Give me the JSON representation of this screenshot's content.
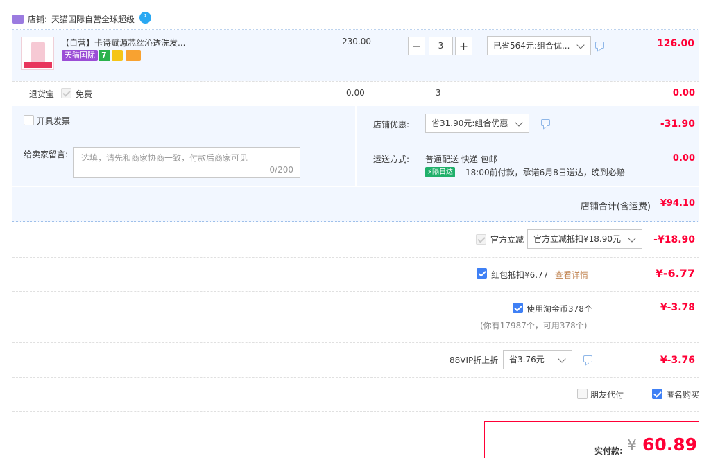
{
  "shop": {
    "label": "店铺:",
    "name": "天猫国际自营全球超级"
  },
  "product": {
    "title": "【自营】卡诗赋源芯丝沁透洗发...",
    "tag": "天猫国际",
    "price": "230.00",
    "qty": "3",
    "discount_select": "已省564元:组合优...",
    "subtotal": "126.00"
  },
  "return_insurance": {
    "label": "退货宝",
    "option": "免费",
    "price": "0.00",
    "qty": "3",
    "total": "0.00"
  },
  "invoice": {
    "label": "开具发票"
  },
  "message": {
    "label": "给卖家留言:",
    "placeholder": "选填，请先和商家协商一致，付款后商家可见",
    "count": "0/200"
  },
  "shop_discount": {
    "label": "店铺优惠:",
    "select": "省31.90元:组合优惠",
    "amount": "-31.90"
  },
  "shipping": {
    "label": "运送方式:",
    "method": "普通配送 快递 包邮",
    "badge": "隔日达",
    "promise": "18:00前付款，承诺6月8日送达，晚到必赔",
    "amount": "0.00"
  },
  "shop_total": {
    "label": "店铺合计(含运费)",
    "amount": "¥94.10"
  },
  "official_discount": {
    "label": "官方立减",
    "select": "官方立减抵扣¥18.90元",
    "amount": "-¥18.90"
  },
  "red_packet": {
    "label": "红包抵扣¥6.77",
    "link": "查看详情",
    "amount": "¥-6.77"
  },
  "taojinbi": {
    "label": "使用淘金币378个",
    "note": "(你有17987个，可用378个)",
    "amount": "¥-3.78"
  },
  "vip": {
    "label": "88VIP折上折",
    "select": "省3.76元",
    "amount": "¥-3.76"
  },
  "options": {
    "friend_pay": "朋友代付",
    "anonymous": "匿名购买"
  },
  "payment": {
    "label": "实付款:",
    "currency": "¥",
    "amount": "60.89"
  },
  "colors": {
    "accent_red": "#ff0036",
    "checkbox_blue": "#3f80f5",
    "row_bg": "#f2f7ff",
    "tmall_purple": "#9b4dd6"
  }
}
